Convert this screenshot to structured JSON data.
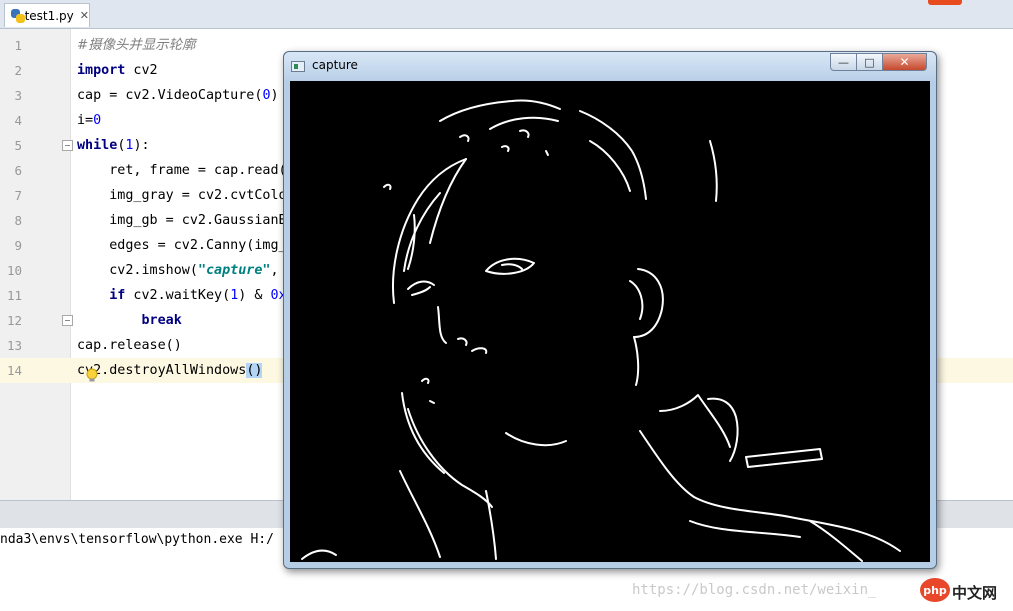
{
  "editor": {
    "tab": {
      "filename": "test1.py",
      "close_glyph": "✕"
    },
    "lines": [
      {
        "n": "1",
        "tokens": [
          {
            "t": "#摄像头并显示轮廓",
            "c": "cmt"
          }
        ]
      },
      {
        "n": "2",
        "tokens": [
          {
            "t": "import",
            "c": "kw"
          },
          {
            "t": " cv2",
            "c": ""
          }
        ]
      },
      {
        "n": "3",
        "tokens": [
          {
            "t": "cap = cv2.VideoCapture(",
            "c": ""
          },
          {
            "t": "0",
            "c": "num-lit"
          },
          {
            "t": ")",
            "c": ""
          }
        ]
      },
      {
        "n": "4",
        "tokens": [
          {
            "t": "i=",
            "c": ""
          },
          {
            "t": "0",
            "c": "num-lit"
          }
        ]
      },
      {
        "n": "5",
        "tokens": [
          {
            "t": "while",
            "c": "kw"
          },
          {
            "t": "(",
            "c": ""
          },
          {
            "t": "1",
            "c": "num-lit"
          },
          {
            "t": "):",
            "c": ""
          }
        ]
      },
      {
        "n": "6",
        "tokens": [
          {
            "t": "    ret, frame = cap.read()",
            "c": ""
          }
        ]
      },
      {
        "n": "7",
        "tokens": [
          {
            "t": "    img_gray = cv2.cvtColo",
            "c": ""
          }
        ]
      },
      {
        "n": "8",
        "tokens": [
          {
            "t": "    img_gb = cv2.GaussianB",
            "c": ""
          }
        ]
      },
      {
        "n": "9",
        "tokens": [
          {
            "t": "    edges = cv2.Canny(img_",
            "c": ""
          }
        ]
      },
      {
        "n": "10",
        "tokens": [
          {
            "t": "    cv2.imshow(",
            "c": ""
          },
          {
            "t": "\"capture\"",
            "c": "str"
          },
          {
            "t": ",",
            "c": ""
          }
        ]
      },
      {
        "n": "11",
        "tokens": [
          {
            "t": "    ",
            "c": ""
          },
          {
            "t": "if",
            "c": "kw"
          },
          {
            "t": " cv2.waitKey(",
            "c": ""
          },
          {
            "t": "1",
            "c": "num-lit"
          },
          {
            "t": ") & ",
            "c": ""
          },
          {
            "t": "0x",
            "c": "num-lit"
          }
        ]
      },
      {
        "n": "12",
        "tokens": [
          {
            "t": "        ",
            "c": ""
          },
          {
            "t": "break",
            "c": "kw"
          }
        ]
      },
      {
        "n": "13",
        "tokens": [
          {
            "t": "cap.release()",
            "c": ""
          }
        ]
      },
      {
        "n": "14",
        "tokens": [
          {
            "t": "cv2.destroyAllWindows",
            "c": ""
          },
          {
            "t": "()",
            "c": "hl"
          }
        ]
      }
    ]
  },
  "console": {
    "command": "nda3\\envs\\tensorflow\\python.exe H:/",
    "watermark": "https://blog.csdn.net/weixin_",
    "badge_logo": "php",
    "badge_site": "中文网"
  },
  "capture_window": {
    "title": "capture",
    "minimize_glyph": "—",
    "maximize_glyph": "□",
    "close_glyph": "✕"
  },
  "icons": {
    "file_tab": "python-file-icon",
    "window": "opencv-window-icon",
    "lightbulb": "lightbulb-icon"
  },
  "colors": {
    "keyword": "#000080",
    "number": "#0000ff",
    "string": "#008080",
    "comment": "#808080",
    "current_line": "#fdf8e2",
    "edge_canvas": "#000000",
    "edges": "#ffffff"
  }
}
